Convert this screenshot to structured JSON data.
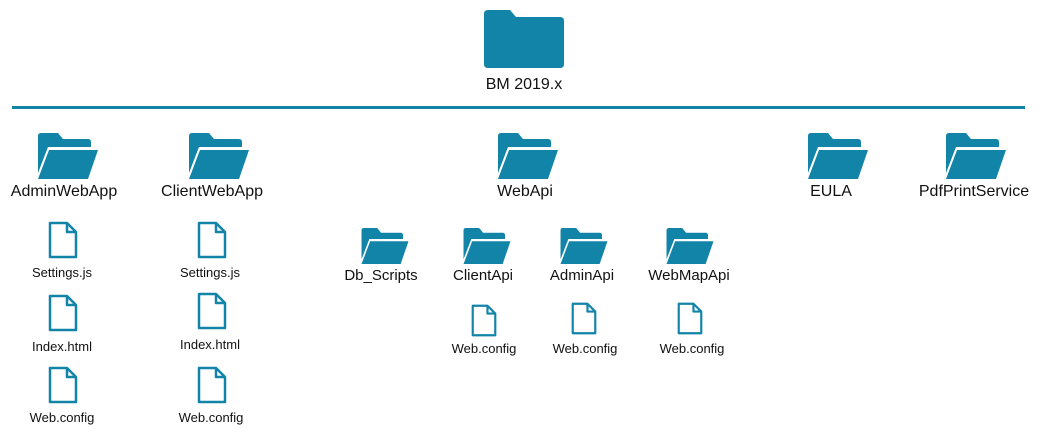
{
  "colors": {
    "folder": "#1284A8",
    "folder_dark": "#0F6F8E",
    "file_stroke": "#1284A8",
    "rule": "#1284A8"
  },
  "root": {
    "label": "BM 2019.x",
    "icon": "folder-closed-icon"
  },
  "top_folders": [
    {
      "label": "AdminWebApp",
      "icon": "folder-open-icon"
    },
    {
      "label": "ClientWebApp",
      "icon": "folder-open-icon"
    },
    {
      "label": "WebApi",
      "icon": "folder-open-icon"
    },
    {
      "label": "EULA",
      "icon": "folder-open-icon"
    },
    {
      "label": "PdfPrintService",
      "icon": "folder-open-icon"
    }
  ],
  "adminwebapp_files": [
    "Settings.js",
    "Index.html",
    "Web.config"
  ],
  "clientwebapp_files": [
    "Settings.js",
    "Index.html",
    "Web.config"
  ],
  "webapi_folders": [
    {
      "label": "Db_Scripts",
      "icon": "folder-open-icon"
    },
    {
      "label": "ClientApi",
      "icon": "folder-open-icon",
      "file": "Web.config"
    },
    {
      "label": "AdminApi",
      "icon": "folder-open-icon",
      "file": "Web.config"
    },
    {
      "label": "WebMapApi",
      "icon": "folder-open-icon",
      "file": "Web.config"
    }
  ]
}
